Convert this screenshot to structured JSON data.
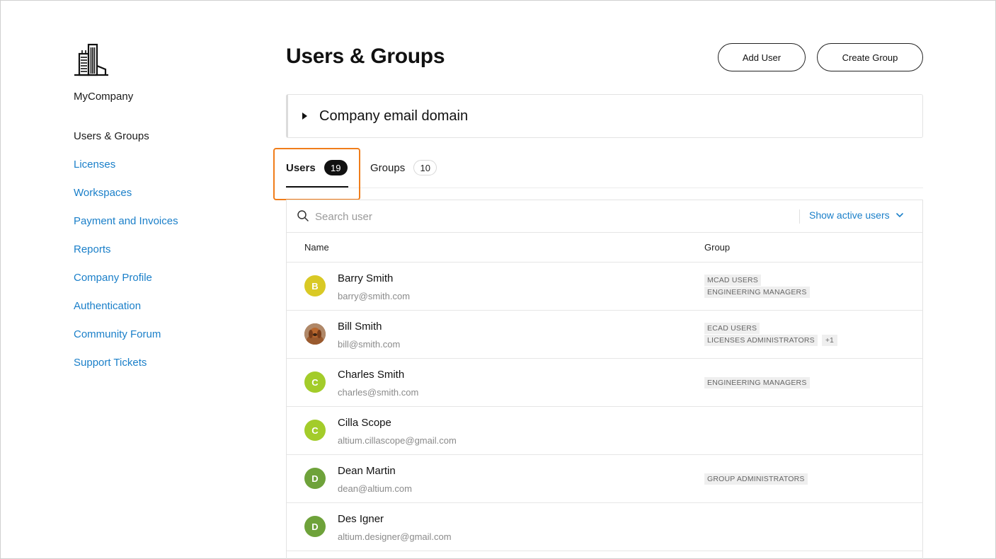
{
  "company": {
    "name": "MyCompany",
    "logo_icon": "building-icon"
  },
  "sidebar": {
    "items": [
      {
        "label": "Users & Groups",
        "active": true
      },
      {
        "label": "Licenses"
      },
      {
        "label": "Workspaces"
      },
      {
        "label": "Payment and Invoices"
      },
      {
        "label": "Reports"
      },
      {
        "label": "Company Profile"
      },
      {
        "label": "Authentication"
      },
      {
        "label": "Community Forum"
      },
      {
        "label": "Support Tickets"
      }
    ]
  },
  "header": {
    "title": "Users & Groups",
    "add_user_label": "Add User",
    "create_group_label": "Create Group"
  },
  "domain_panel": {
    "label": "Company email domain"
  },
  "tabs": [
    {
      "label": "Users",
      "count": "19",
      "active": true
    },
    {
      "label": "Groups",
      "count": "10"
    }
  ],
  "search": {
    "placeholder": "Search user",
    "filter_label": "Show active users"
  },
  "table": {
    "columns": {
      "name": "Name",
      "group": "Group"
    },
    "rows": [
      {
        "initial": "B",
        "avatar_color": "#d9c925",
        "name": "Barry Smith",
        "email": "barry@smith.com",
        "groups": [
          "MCAD USERS",
          "ENGINEERING MANAGERS"
        ],
        "more": ""
      },
      {
        "initial": "",
        "avatar_color": "#8a5a3a",
        "avatar_photo": true,
        "name": "Bill Smith",
        "email": "bill@smith.com",
        "groups": [
          "ECAD USERS",
          "LICENSES ADMINISTRATORS"
        ],
        "more": "+1"
      },
      {
        "initial": "C",
        "avatar_color": "#a3cc2a",
        "name": "Charles Smith",
        "email": "charles@smith.com",
        "groups": [
          "ENGINEERING MANAGERS"
        ],
        "more": ""
      },
      {
        "initial": "C",
        "avatar_color": "#a3cc2a",
        "name": "Cilla Scope",
        "email": "altium.cillascope@gmail.com",
        "groups": [],
        "more": ""
      },
      {
        "initial": "D",
        "avatar_color": "#6ea23a",
        "name": "Dean Martin",
        "email": "dean@altium.com",
        "groups": [
          "GROUP ADMINISTRATORS"
        ],
        "more": ""
      },
      {
        "initial": "D",
        "avatar_color": "#6ea23a",
        "name": "Des Igner",
        "email": "altium.designer@gmail.com",
        "groups": [],
        "more": ""
      }
    ]
  },
  "colors": {
    "link": "#1a7fc9",
    "highlight": "#f07d1a"
  }
}
